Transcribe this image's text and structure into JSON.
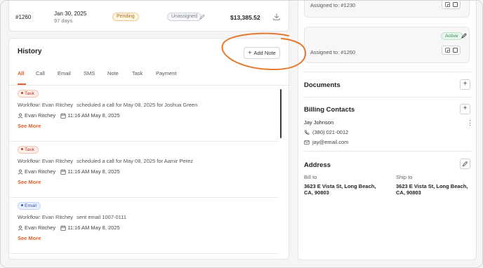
{
  "invoice_row": {
    "id": "#1260",
    "date": "Jan 30, 2025",
    "days": "97 days",
    "status": "Pending",
    "assignee": "Unassigned",
    "amount": "$13,385.52",
    "icons": {
      "edit": "pencil-icon",
      "download": "download-icon"
    }
  },
  "history": {
    "title": "History",
    "add_note_label": "Add Note",
    "tabs": [
      "All",
      "Call",
      "Email",
      "SMS",
      "Note",
      "Task",
      "Payment"
    ],
    "active_tab": "All",
    "entries": [
      {
        "type": "Task",
        "description": "Workflow: Evan Ritchey",
        "action": "scheduled a call for May 08, 2025 for Joshua Green",
        "user": "Evan Ritchey",
        "time": "11:16 AM May 8, 2025",
        "see_more": "See More"
      },
      {
        "type": "Task",
        "description": "Workflow: Evan Ritchey",
        "action": "scheduled a call for May 08, 2025 for Aamir Perez",
        "user": "Evan Ritchey",
        "time": "11:16 AM May 8, 2025",
        "see_more": "See More"
      },
      {
        "type": "Email",
        "description": "Workflow: Evan Ritchey",
        "action": "sent email 1007-0111",
        "user": "Evan Ritchey",
        "time": "11:16 AM May 8, 2025",
        "see_more": "See More"
      }
    ]
  },
  "right_panel": {
    "assign1": "Assigned to: #1230",
    "assign2": "Assigned to: #1260",
    "active_label": "Active",
    "documents_title": "Documents",
    "billing_title": "Billing Contacts",
    "contact": {
      "name": "Jay Johnson",
      "phone": "(380) 021-0012",
      "email": "jay@email.com"
    },
    "address_title": "Address",
    "bill_to_label": "Bill to",
    "bill_to": "3623 E Vista St, Long Beach, CA, 90803",
    "ship_to_label": "Ship to",
    "ship_to": "3623 E Vista St, Long Beach, CA, 90803"
  },
  "colors": {
    "accent": "#e2622a",
    "annotation": "#e57a2e",
    "pending": "#b07018",
    "active": "#2d8a4a",
    "email_badge": "#2c5bb5"
  }
}
